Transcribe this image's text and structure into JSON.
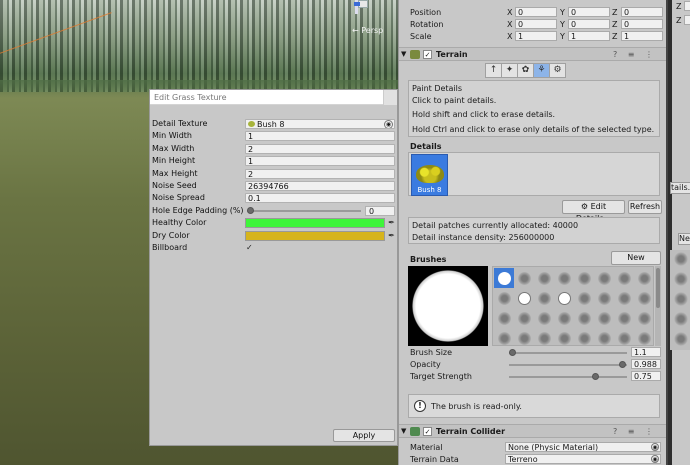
{
  "scene": {
    "view_label": "← Persp"
  },
  "grass_window": {
    "title": "Edit Grass Texture",
    "fields": {
      "detail_texture": {
        "label": "Detail Texture",
        "value": "Bush 8"
      },
      "min_width": {
        "label": "Min Width",
        "value": "1"
      },
      "max_width": {
        "label": "Max Width",
        "value": "2"
      },
      "min_height": {
        "label": "Min Height",
        "value": "1"
      },
      "max_height": {
        "label": "Max Height",
        "value": "2"
      },
      "noise_seed": {
        "label": "Noise Seed",
        "value": "26394766"
      },
      "noise_spread": {
        "label": "Noise Spread",
        "value": "0.1"
      },
      "hole_edge_padding": {
        "label": "Hole Edge Padding (%)",
        "value": "0",
        "fraction": 0
      },
      "healthy_color": {
        "label": "Healthy Color",
        "color": "#3ef53a"
      },
      "dry_color": {
        "label": "Dry Color",
        "color": "#d6b41c"
      },
      "billboard": {
        "label": "Billboard",
        "checked": true,
        "mark": "✓"
      }
    },
    "apply_label": "Apply"
  },
  "inspector": {
    "transform": {
      "position": {
        "label": "Position",
        "x": "0",
        "y": "0",
        "z": "0"
      },
      "rotation": {
        "label": "Rotation",
        "x": "0",
        "y": "0",
        "z": "0"
      },
      "scale": {
        "label": "Scale",
        "x": "1",
        "y": "1",
        "z": "1"
      },
      "axis_x": "X",
      "axis_y": "Y",
      "axis_z": "Z"
    },
    "terrain": {
      "title": "Terrain",
      "header_icons": "? ≡ ⋮",
      "tools": [
        "↑",
        "✦",
        "✿",
        "⚘",
        "⚙"
      ],
      "active_tool": 3,
      "paint_details": {
        "heading": "Paint Details",
        "line1": "Click to paint details.",
        "line2": "Hold shift and click to erase details.",
        "line3": "Hold Ctrl and click to erase only details of the selected type."
      },
      "details_heading": "Details",
      "detail_item": "Bush 8",
      "edit_details_label": "⚙ Edit Details...",
      "refresh_label": "Refresh",
      "patches_text": "Detail patches currently allocated: 40000",
      "density_text": "Detail instance density: 256000000",
      "brushes_heading": "Brushes",
      "new_brush_label": "New Brush...",
      "brush_size": {
        "label": "Brush Size",
        "value": "1.1",
        "fraction": 0.0
      },
      "opacity": {
        "label": "Opacity",
        "value": "0.988",
        "fraction": 0.99
      },
      "target_strength": {
        "label": "Target Strength",
        "value": "0.75",
        "fraction": 0.75
      },
      "read_only_text": "The brush is read-only.",
      "info_symbol": "!"
    },
    "terrain_collider": {
      "title": "Terrain Collider",
      "header_icons": "? ≡ ⋮",
      "material": {
        "label": "Material",
        "value": "None (Physic Material)"
      },
      "terrain_data": {
        "label": "Terrain Data",
        "value": "Terreno"
      }
    }
  },
  "right_panel": {
    "z1": "Z",
    "z2": "Z",
    "button1": "tails...",
    "button2": "Ne"
  },
  "colors": {
    "accent_blue": "#3c7ad6",
    "panel_gray": "#c8c8c8"
  }
}
